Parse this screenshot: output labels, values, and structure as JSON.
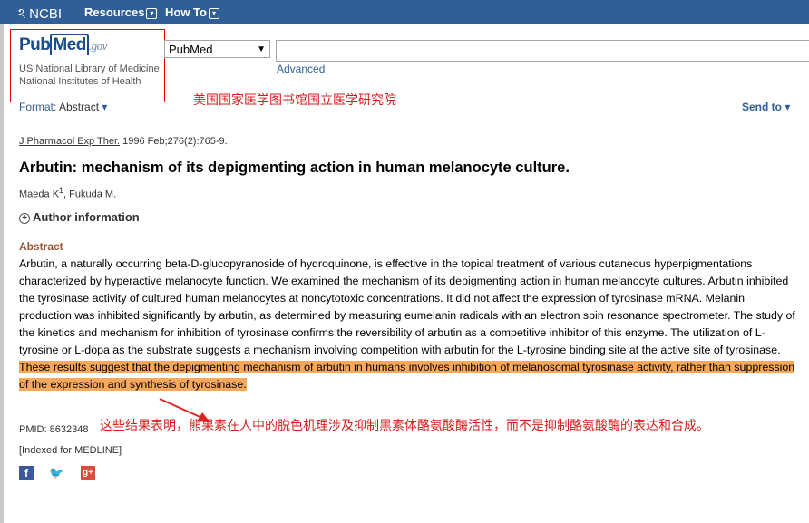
{
  "topbar": {
    "brand": "NCBI",
    "nav": [
      {
        "label": "Resources"
      },
      {
        "label": "How To"
      }
    ]
  },
  "logo": {
    "text_pub": "Pub",
    "text_med": "Med",
    "text_gov": ".gov",
    "subtitle": "US National Library of Medicine National Institutes of Health"
  },
  "search": {
    "database": "PubMed",
    "query": "",
    "advanced_label": "Advanced"
  },
  "annotations": {
    "nlm_cn": "美国国家医学图书馆国立医学研究院",
    "conclusion_cn": "这些结果表明，熊果素在人中的脱色机理涉及抑制黑素体酪氨酸酶活性，而不是抑制酪氨酸酶的表达和合成。"
  },
  "toolbar": {
    "format_label": "Format:",
    "format_value": "Abstract",
    "send_to_label": "Send to"
  },
  "article": {
    "journal": "J Pharmacol Exp Ther.",
    "citation": "1996 Feb;276(2):765-9.",
    "title": "Arbutin: mechanism of its depigmenting action in human melanocyte culture.",
    "authors": [
      {
        "name": "Maeda K",
        "sup": "1"
      },
      {
        "name": "Fukuda M",
        "sup": ""
      }
    ],
    "author_info_label": "Author information",
    "abstract_heading": "Abstract",
    "abstract_main": "Arbutin, a naturally occurring beta-D-glucopyranoside of hydroquinone, is effective in the topical treatment of various cutaneous hyperpigmentations characterized by hyperactive melanocyte function. We examined the mechanism of its depigmenting action in human melanocyte cultures. Arbutin inhibited the tyrosinase activity of cultured human melanocytes at noncytotoxic concentrations. It did not affect the expression of tyrosinase mRNA. Melanin production was inhibited significantly by arbutin, as determined by measuring eumelanin radicals with an electron spin resonance spectrometer. The study of the kinetics and mechanism for inhibition of tyrosinase confirms the reversibility of arbutin as a competitive inhibitor of this enzyme. The utilization of L-tyrosine or L-dopa as the substrate suggests a mechanism involving competition with arbutin for the L-tyrosine binding site at the active site of tyrosinase. ",
    "abstract_highlight": "These results suggest that the depigmenting mechanism of arbutin in humans involves inhibition of melanosomal tyrosinase activity, rather than suppression of the expression and synthesis of tyrosinase.",
    "pmid": "PMID: 8632348",
    "indexed": "[Indexed for MEDLINE]"
  },
  "social": {
    "facebook_glyph": "f",
    "twitter_glyph": "🐦",
    "gplus_glyph": "g+"
  },
  "colors": {
    "topbar": "#2f5f96",
    "highlight": "#f7a85a",
    "annotation_red": "#d91e1e",
    "abstract_heading": "#985735"
  }
}
